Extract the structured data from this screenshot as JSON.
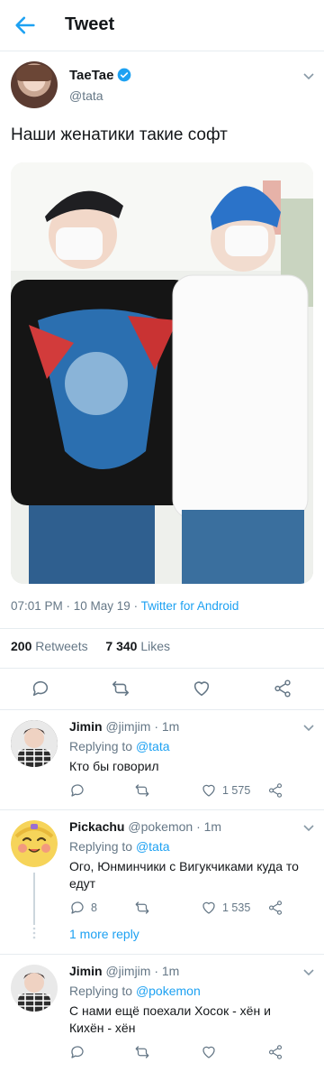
{
  "header": {
    "title": "Tweet"
  },
  "tweet": {
    "author_name": "TaeTae",
    "author_handle": "@tata",
    "text": "Наши женатики такие софт",
    "time": "07:01 PM · 10 May 19 · ",
    "source": "Twitter for Android",
    "retweets_count": "200",
    "retweets_label": "Retweets",
    "likes_count": "7 340",
    "likes_label": "Likes"
  },
  "replies": [
    {
      "name": "Jimin",
      "handle_time": "@jimjim · 1m",
      "replying_prefix": "Replying to",
      "replying_to": "@tata",
      "text": "Кто бы говорил",
      "reply_count": "",
      "like_count": "1 575"
    },
    {
      "name": "Pickachu",
      "handle_time": "@pokemon · 1m",
      "replying_prefix": "Replying to",
      "replying_to": "@tata",
      "text": "Ого, Юнминчики с Вигукчиками куда то едут",
      "reply_count": "8",
      "like_count": "1 535"
    },
    {
      "name": "Jimin",
      "handle_time": "@jimjim · 1m",
      "replying_prefix": "Replying to",
      "replying_to": "@pokemon",
      "text": "С нами ещё поехали Хосок - хён и Кихён - хён",
      "reply_count": "",
      "like_count": ""
    }
  ],
  "more_replies_label": "1 more reply",
  "colors": {
    "accent": "#1da1f2",
    "secondary_text": "#657786",
    "divider": "#e6ecf0"
  }
}
